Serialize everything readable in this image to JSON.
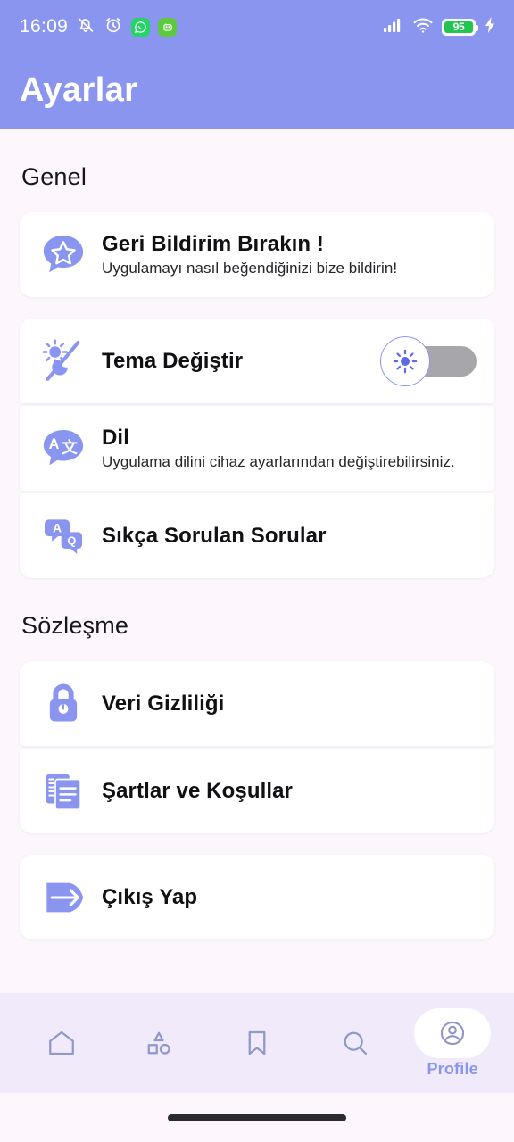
{
  "status_bar": {
    "time": "16:09",
    "left_icons": [
      "mute-bell-icon",
      "alarm-clock-icon",
      "whatsapp-icon",
      "green-app-icon"
    ],
    "right_icons": [
      "cellular-signal-icon",
      "wifi-icon",
      "battery-icon",
      "charging-bolt-icon"
    ],
    "battery_percent": "95"
  },
  "header": {
    "title": "Ayarlar",
    "background_color": "#8a95f0"
  },
  "theme": {
    "page_background": "#fdf7fd",
    "card_background": "#ffffff",
    "accent": "#8a95f0",
    "nav_background": "#f0eafa",
    "toggle_track": "#a7a7ab"
  },
  "sections": [
    {
      "title": "Genel",
      "groups": [
        {
          "rows": [
            {
              "icon": "feedback-star-bubble-icon",
              "title": "Geri Bildirim Bırakın !",
              "subtitle": "Uygulamayı nasıl beğendiğinizi bize bildirin!"
            }
          ]
        },
        {
          "rows": [
            {
              "icon": "theme-sun-moon-icon",
              "title": "Tema Değiştir",
              "subtitle": "",
              "control": "toggle",
              "toggle_state": "off",
              "toggle_knob_icon": "sun-icon"
            },
            {
              "icon": "language-translate-bubble-icon",
              "title": "Dil",
              "subtitle": "Uygulama dilini cihaz ayarlarından değiştirebilirsiniz."
            },
            {
              "icon": "faq-chat-bubbles-icon",
              "title": "Sıkça Sorulan Sorular",
              "subtitle": ""
            }
          ]
        }
      ]
    },
    {
      "title": "Sözleşme",
      "groups": [
        {
          "rows": [
            {
              "icon": "lock-icon",
              "title": "Veri Gizliliği",
              "subtitle": ""
            },
            {
              "icon": "documents-icon",
              "title": "Şartlar ve Koşullar",
              "subtitle": ""
            }
          ]
        },
        {
          "rows": [
            {
              "icon": "logout-arrow-icon",
              "title": "Çıkış Yap",
              "subtitle": ""
            }
          ]
        }
      ]
    }
  ],
  "bottom_nav": {
    "items": [
      {
        "icon": "home-icon",
        "label": "",
        "active": false
      },
      {
        "icon": "shapes-icon",
        "label": "",
        "active": false
      },
      {
        "icon": "bookmark-icon",
        "label": "",
        "active": false
      },
      {
        "icon": "search-icon",
        "label": "",
        "active": false
      },
      {
        "icon": "profile-icon",
        "label": "Profile",
        "active": true
      }
    ]
  }
}
